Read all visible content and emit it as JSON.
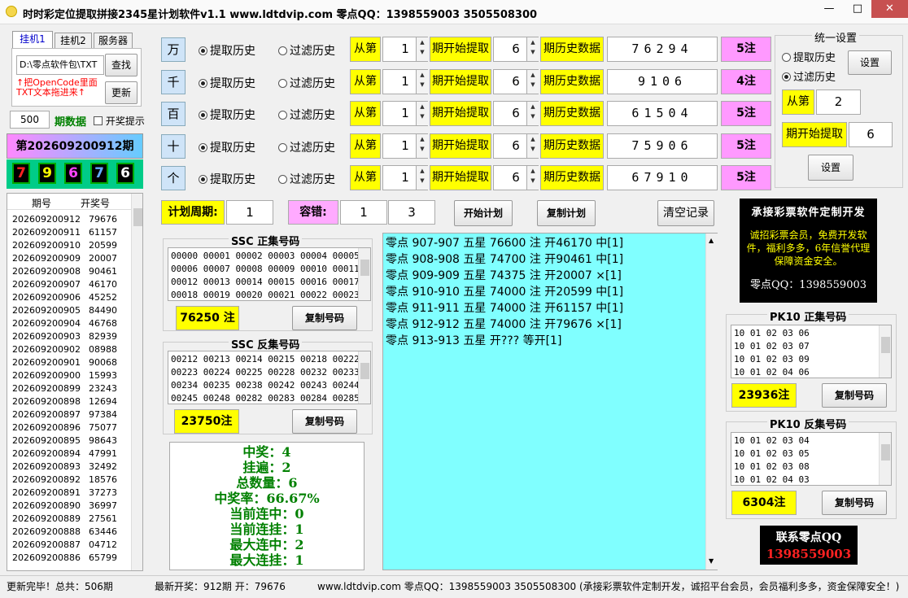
{
  "title": "时时彩定位提取拼接2345星计划软件v1.1    www.ldtdvip.com     零点QQ：1398559003  3505508300",
  "window": {
    "min": "—",
    "max": "□",
    "close": "✕"
  },
  "tabs": [
    "挂机1",
    "挂机2",
    "服务器"
  ],
  "path_value": "D:\\零点软件包\\TXT",
  "find_btn": "查找",
  "update_btn": "更新",
  "hint_text": "↑把OpenCode里面TXT文本拖进来↑",
  "count_value": "500",
  "period_data_label": "期数据",
  "open_hint_label": "开奖提示",
  "current_period": "第202609200912期",
  "last_balls": [
    {
      "n": "7",
      "c": "#ff2222"
    },
    {
      "n": "9",
      "c": "#ffff00"
    },
    {
      "n": "6",
      "c": "#ff44ff"
    },
    {
      "n": "7",
      "c": "#66aaff"
    },
    {
      "n": "6",
      "c": "#ffffff"
    }
  ],
  "history_headers": [
    "期号",
    "开奖号"
  ],
  "history": [
    [
      "202609200912",
      "79676"
    ],
    [
      "202609200911",
      "61157"
    ],
    [
      "202609200910",
      "20599"
    ],
    [
      "202609200909",
      "20007"
    ],
    [
      "202609200908",
      "90461"
    ],
    [
      "202609200907",
      "46170"
    ],
    [
      "202609200906",
      "45252"
    ],
    [
      "202609200905",
      "84490"
    ],
    [
      "202609200904",
      "46768"
    ],
    [
      "202609200903",
      "82939"
    ],
    [
      "202609200902",
      "08988"
    ],
    [
      "202609200901",
      "90068"
    ],
    [
      "202609200900",
      "15993"
    ],
    [
      "202609200899",
      "23243"
    ],
    [
      "202609200898",
      "12694"
    ],
    [
      "202609200897",
      "97384"
    ],
    [
      "202609200896",
      "75077"
    ],
    [
      "202609200895",
      "98643"
    ],
    [
      "202609200894",
      "47991"
    ],
    [
      "202609200893",
      "32492"
    ],
    [
      "202609200892",
      "18576"
    ],
    [
      "202609200891",
      "37273"
    ],
    [
      "202609200890",
      "36997"
    ],
    [
      "202609200889",
      "27561"
    ],
    [
      "202609200888",
      "63446"
    ],
    [
      "202609200887",
      "04712"
    ],
    [
      "202609200886",
      "65799"
    ]
  ],
  "positions": [
    {
      "digit": "万",
      "opt1": "提取历史",
      "opt2": "过滤历史",
      "sel": 1,
      "from": "从第",
      "from_val": "1",
      "start": "期开始提取",
      "start_val": "6",
      "hist": "期历史数据",
      "nums": "76294",
      "bets": "5注"
    },
    {
      "digit": "千",
      "opt1": "提取历史",
      "opt2": "过滤历史",
      "sel": 1,
      "from": "从第",
      "from_val": "1",
      "start": "期开始提取",
      "start_val": "6",
      "hist": "期历史数据",
      "nums": "9106",
      "bets": "4注"
    },
    {
      "digit": "百",
      "opt1": "提取历史",
      "opt2": "过滤历史",
      "sel": 1,
      "from": "从第",
      "from_val": "1",
      "start": "期开始提取",
      "start_val": "6",
      "hist": "期历史数据",
      "nums": "61504",
      "bets": "5注"
    },
    {
      "digit": "十",
      "opt1": "提取历史",
      "opt2": "过滤历史",
      "sel": 1,
      "from": "从第",
      "from_val": "1",
      "start": "期开始提取",
      "start_val": "6",
      "hist": "期历史数据",
      "nums": "75906",
      "bets": "5注"
    },
    {
      "digit": "个",
      "opt1": "提取历史",
      "opt2": "过滤历史",
      "sel": 1,
      "from": "从第",
      "from_val": "1",
      "start": "期开始提取",
      "start_val": "6",
      "hist": "期历史数据",
      "nums": "67910",
      "bets": "5注"
    }
  ],
  "unified": {
    "title": "统一设置",
    "opt1": "提取历史",
    "opt2": "过滤历史",
    "set_btn": "设置",
    "from": "从第",
    "from_val": "2",
    "start": "期开始提取",
    "start_val": "6",
    "set_btn2": "设置"
  },
  "plan": {
    "cycle_label": "计划周期:",
    "cycle_val": "1",
    "tol_label": "容错:",
    "tol_a": "1",
    "tol_b": "3",
    "start_btn": "开始计划",
    "copy_btn": "复制计划",
    "clear_btn": "清空记录"
  },
  "ssc_pos": {
    "title": "SSC 正集号码",
    "lines": [
      "00000 00001 00002 00003 00004 00005",
      "00006 00007 00008 00009 00010 00011",
      "00012 00013 00014 00015 00016 00017",
      "00018 00019 00020 00021 00022 00023"
    ],
    "count": "76250 注",
    "copy": "复制号码"
  },
  "ssc_neg": {
    "title": "SSC 反集号码",
    "lines": [
      "00212 00213 00214 00215 00218 00222",
      "00223 00224 00225 00228 00232 00233",
      "00234 00235 00238 00242 00243 00244",
      "00245 00248 00282 00283 00284 00285"
    ],
    "count": "23750注",
    "copy": "复制号码"
  },
  "stats": [
    "中奖：4",
    "挂遍：2",
    "总数量：6",
    "中奖率：66.67%",
    "当前连中：0",
    "当前连挂：1",
    "最大连中：2",
    "最大连挂：1"
  ],
  "log": [
    "零点 907-907 五星 76600 注 开46170 中[1]",
    "零点 908-908 五星 74700 注 开90461 中[1]",
    "零点 909-909 五星 74375 注 开20007 ×[1]",
    "零点 910-910 五星 74000 注 开20599 中[1]",
    "零点 911-911 五星 74000 注 开61157 中[1]",
    "零点 912-912 五星 74000 注 开79676 ×[1]",
    "零点 913-913 五星 开???  等开[1]"
  ],
  "ad": {
    "line1": "承接彩票软件定制开发",
    "line2": "诚招彩票会员，免费开发软件，福利多多，6年信誉代理保障资金安全。",
    "line3": "零点QQ：1398559003"
  },
  "pk_pos": {
    "title": "PK10 正集号码",
    "lines": [
      "10 01 02 03 06",
      "10 01 02 03 07",
      "10 01 02 03 09",
      "10 01 02 04 06"
    ],
    "count": "23936注",
    "copy": "复制号码"
  },
  "pk_neg": {
    "title": "PK10 反集号码",
    "lines": [
      "10 01 02 03 04",
      "10 01 02 03 05",
      "10 01 02 03 08",
      "10 01 02 04 03"
    ],
    "count": "6304注",
    "copy": "复制号码"
  },
  "contact": {
    "line1": "联系零点QQ",
    "line2": "1398559003"
  },
  "status": {
    "s1": "更新完毕！总共：506期",
    "s2": "最新开奖：912期 开：79676",
    "s3": "www.ldtdvip.com   零点QQ：1398559003  3505508300   (承接彩票软件定制开发，诚招平台会员，会员福利多多，资金保障安全！)"
  }
}
